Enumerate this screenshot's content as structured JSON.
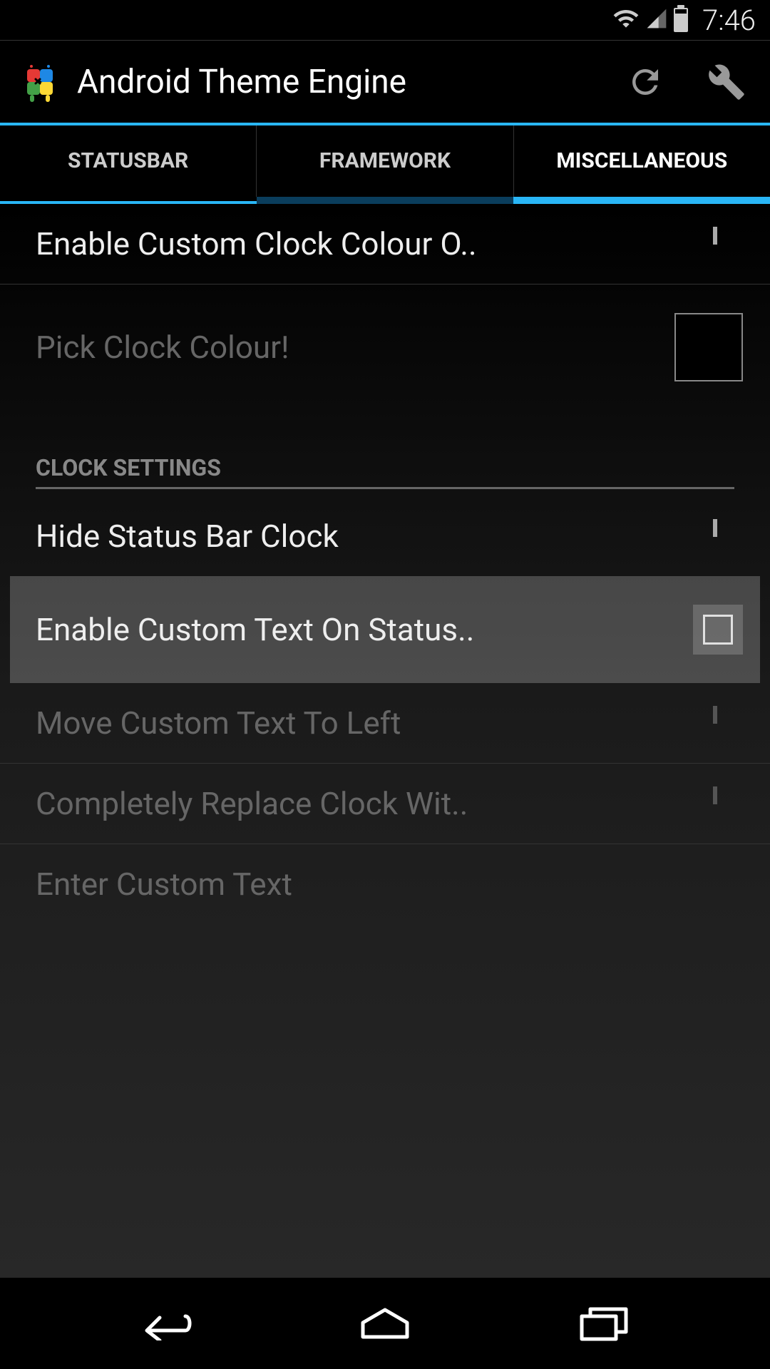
{
  "status_bar": {
    "time": "7:46"
  },
  "action_bar": {
    "title": "Android Theme Engine"
  },
  "tabs": [
    {
      "label": "STATUSBAR",
      "active": false
    },
    {
      "label": "FRAMEWORK",
      "active": false
    },
    {
      "label": "MISCELLANEOUS",
      "active": true
    }
  ],
  "settings": {
    "enable_clock_colour": "Enable Custom Clock Colour O..",
    "pick_clock_colour": "Pick Clock Colour!",
    "section_clock": "CLOCK SETTINGS",
    "hide_clock": "Hide Status Bar Clock",
    "enable_custom_text": "Enable Custom Text On Status..",
    "move_text_left": "Move Custom Text To Left",
    "replace_clock": "Completely Replace Clock Wit..",
    "enter_custom_text": "Enter Custom Text",
    "clock_colour_value": "#000000"
  }
}
